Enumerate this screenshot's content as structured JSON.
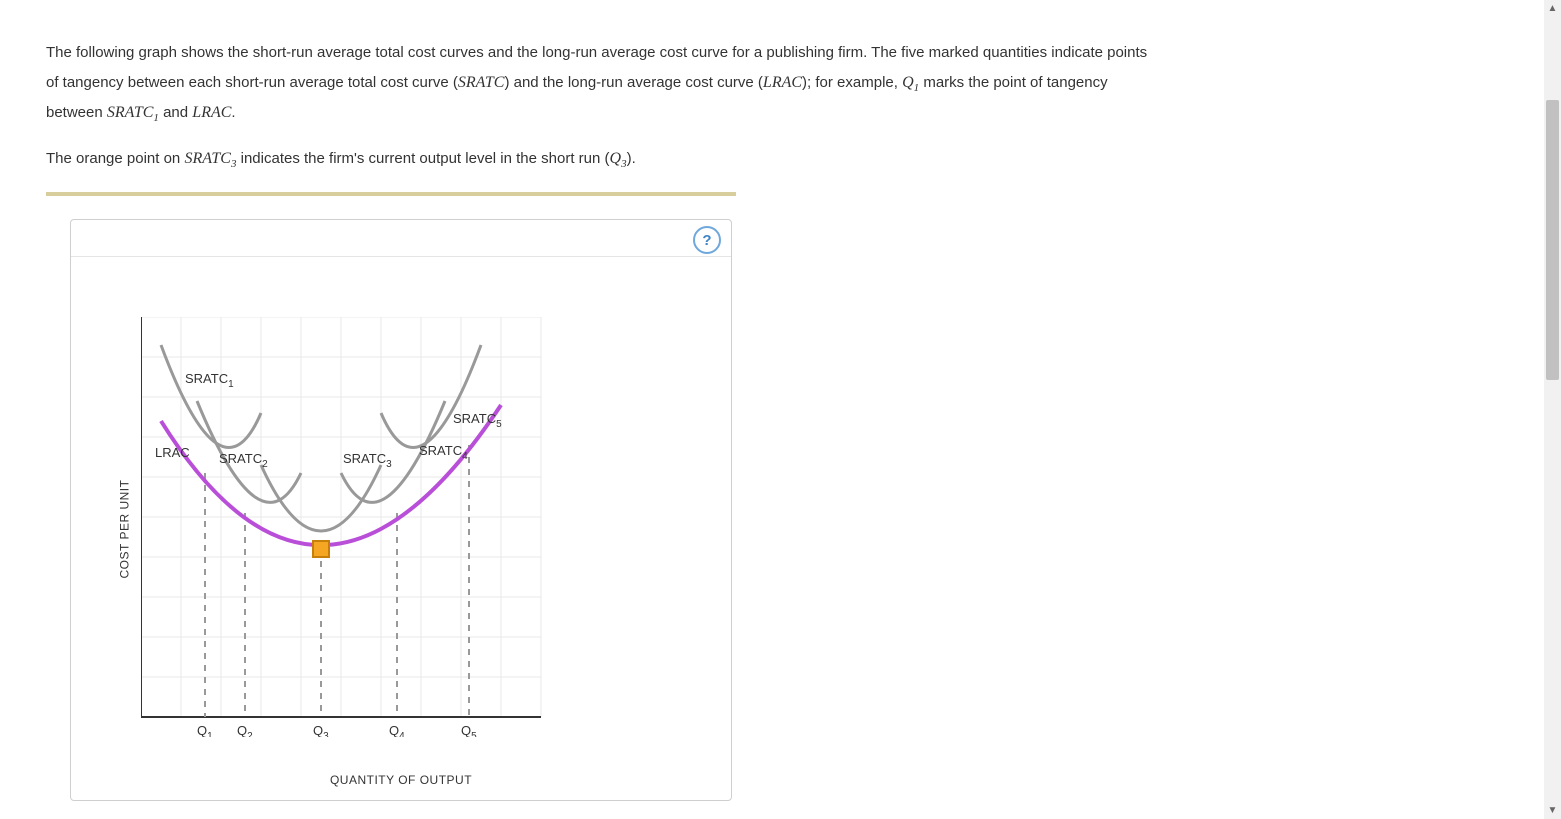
{
  "question": {
    "para1_a": "The following graph shows the short-run average total cost curves and the long-run average cost curve for a publishing firm. The five marked quantities indicate points of tangency between each short-run average total cost curve (",
    "sratc": "SRATC",
    "para1_b": ") and the long-run average cost curve (",
    "lrac": "LRAC",
    "para1_c": "); for example, ",
    "q1": "Q",
    "q1_sub": "1",
    "para1_d": " marks the point of tangency between ",
    "sratc1": "SRATC",
    "sratc1_sub": "1",
    "para1_e": " and ",
    "lrac2": "LRAC",
    "para1_f": ".",
    "para2_a": "The orange point on ",
    "sratc3": "SRATC",
    "sratc3_sub": "3",
    "para2_b": " indicates the firm's current output level in the short run (",
    "q3": "Q",
    "q3_sub": "3",
    "para2_c": ")."
  },
  "chart": {
    "help_label": "?",
    "ylabel": "COST PER UNIT",
    "xlabel": "QUANTITY OF OUTPUT",
    "labels": {
      "lrac": "LRAC",
      "sratc1": "SRATC",
      "sratc1_sub": "1",
      "sratc2": "SRATC",
      "sratc2_sub": "2",
      "sratc3": "SRATC",
      "sratc3_sub": "3",
      "sratc4": "SRATC",
      "sratc4_sub": "4",
      "sratc5": "SRATC",
      "sratc5_sub": "5"
    },
    "xticks": {
      "q1": "Q",
      "q1_sub": "1",
      "q2": "Q",
      "q2_sub": "2",
      "q3": "Q",
      "q3_sub": "3",
      "q4": "Q",
      "q4_sub": "4",
      "q5": "Q",
      "q5_sub": "5"
    }
  },
  "chart_data": {
    "type": "line",
    "title": "",
    "xlabel": "QUANTITY OF OUTPUT",
    "ylabel": "COST PER UNIT",
    "xlim": [
      0,
      10
    ],
    "ylim": [
      0,
      10
    ],
    "series": [
      {
        "name": "LRAC",
        "x": [
          0.5,
          1,
          2,
          3,
          4,
          5,
          6,
          7,
          8,
          9
        ],
        "y": [
          7.4,
          6.8,
          5.6,
          4.7,
          4.2,
          4.2,
          4.7,
          5.6,
          6.8,
          7.4
        ]
      },
      {
        "name": "SRATC1",
        "x": [
          0.5,
          1,
          1.5,
          2,
          2.5,
          3
        ],
        "y": [
          9.3,
          7.6,
          6.6,
          6.3,
          6.6,
          7.6
        ]
      },
      {
        "name": "SRATC2",
        "x": [
          1.4,
          2,
          2.5,
          3,
          3.5,
          4
        ],
        "y": [
          7.9,
          6.1,
          5.3,
          5.0,
          5.3,
          6.1
        ]
      },
      {
        "name": "SRATC3",
        "x": [
          3,
          3.5,
          4,
          4.5,
          5,
          5.5,
          6
        ],
        "y": [
          6.3,
          5.1,
          4.4,
          4.2,
          4.4,
          5.1,
          6.3
        ]
      },
      {
        "name": "SRATC4",
        "x": [
          5,
          5.5,
          6,
          6.5,
          7,
          7.6
        ],
        "y": [
          6.1,
          5.3,
          5.0,
          5.3,
          6.1,
          7.9
        ]
      },
      {
        "name": "SRATC5",
        "x": [
          6,
          6.5,
          7,
          7.5,
          8,
          8.5
        ],
        "y": [
          7.6,
          6.6,
          6.3,
          6.6,
          7.6,
          9.3
        ]
      }
    ],
    "tangency_points": [
      {
        "label": "Q1",
        "x": 1.6,
        "y": 6.1
      },
      {
        "label": "Q2",
        "x": 2.6,
        "y": 5.1
      },
      {
        "label": "Q3",
        "x": 4.5,
        "y": 4.2
      },
      {
        "label": "Q4",
        "x": 6.4,
        "y": 5.1
      },
      {
        "label": "Q5",
        "x": 8.2,
        "y": 6.8
      }
    ],
    "current_output_point": {
      "x": 4.5,
      "y": 4.2,
      "color": "#f5a623"
    },
    "colors": {
      "lrac": "#b94fd8",
      "sratc": "#999999",
      "grid": "#e9e9e9",
      "dashed": "#999999"
    }
  }
}
